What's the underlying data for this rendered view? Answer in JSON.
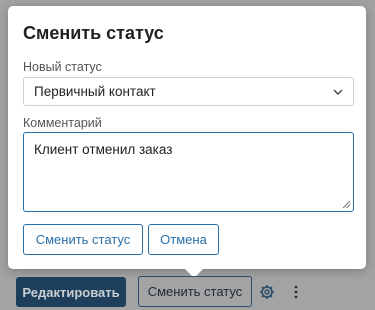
{
  "dialog": {
    "title": "Сменить статус",
    "status_label": "Новый статус",
    "status_value": "Первичный контакт",
    "comment_label": "Комментарий",
    "comment_value": "Клиент отменил заказ",
    "submit_label": "Сменить статус",
    "cancel_label": "Отмена"
  },
  "toolbar": {
    "edit_label": "Редактировать",
    "change_status_label": "Сменить статус",
    "settings_icon": "gear-icon",
    "more_icon": "kebab-menu-icon"
  },
  "colors": {
    "accent": "#2a6fa8",
    "primary_dark": "#1e3f5c",
    "overlay": "#a3a3a3"
  }
}
